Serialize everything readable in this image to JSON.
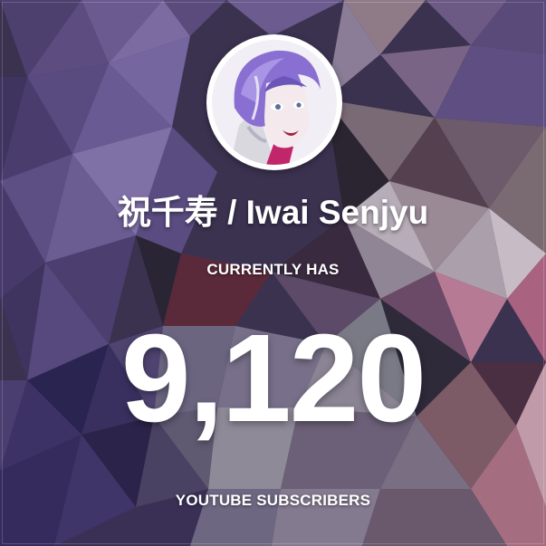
{
  "channel": {
    "name": "祝千寿 / Iwai Senjyu",
    "avatar_icon": "channel-avatar-icon"
  },
  "counter": {
    "caption_top": "CURRENTLY HAS",
    "value": "9,120",
    "caption_bottom": "YOUTUBE SUBSCRIBERS"
  },
  "theme": {
    "accent": "#7a62a8",
    "background": "#3b3250",
    "text": "#ffffff"
  }
}
